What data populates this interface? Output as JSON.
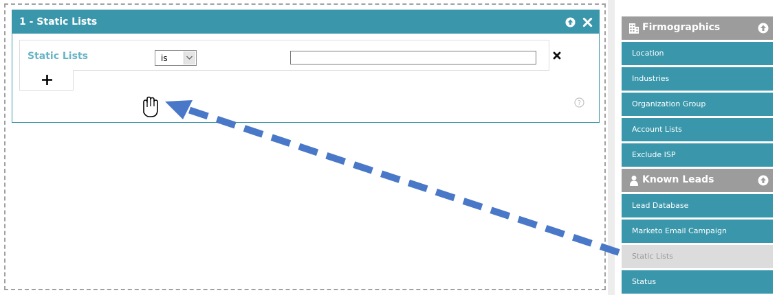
{
  "panel": {
    "title": "1 - Static Lists",
    "icons": {
      "collapse": "arrow-up-circle-icon",
      "close": "close-icon"
    }
  },
  "filter_row": {
    "label": "Static Lists",
    "operator": {
      "selected": "is",
      "icon": "chevron-down-icon"
    },
    "value": "",
    "remove_icon": "close-icon"
  },
  "add_button": {
    "icon": "plus-icon"
  },
  "help_icon": "question-circle-icon",
  "sidebar": {
    "sections": [
      {
        "title": "Firmographics",
        "icon": "building-icon",
        "collapse_icon": "arrow-up-circle-icon",
        "items": [
          {
            "label": "Location"
          },
          {
            "label": "Industries"
          },
          {
            "label": "Organization Group"
          },
          {
            "label": "Account Lists"
          },
          {
            "label": "Exclude ISP"
          }
        ]
      },
      {
        "title": "Known Leads",
        "icon": "person-icon",
        "collapse_icon": "arrow-up-circle-icon",
        "items": [
          {
            "label": "Lead Database"
          },
          {
            "label": "Marketo Email Campaign"
          },
          {
            "label": "Static Lists",
            "disabled": true
          },
          {
            "label": "Status"
          }
        ]
      }
    ]
  },
  "annotation": {
    "type": "drag-arrow",
    "color": "#4a78c8",
    "cursor": "hand-grab-icon"
  },
  "colors": {
    "teal": "#3a97ab",
    "label_teal": "#67b3c6",
    "section_gray": "#9c9c9c",
    "disabled_gray": "#dcdcdc"
  }
}
